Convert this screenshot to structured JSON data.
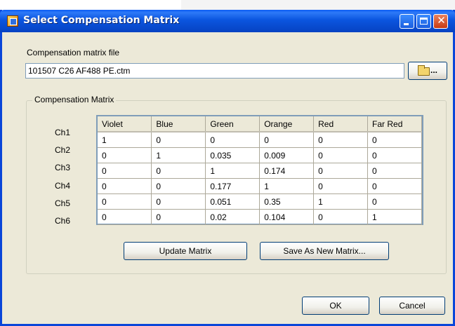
{
  "window": {
    "title": "Select Compensation Matrix",
    "controls": {
      "minimize": "minimize-icon",
      "maximize": "maximize-icon",
      "close": "close-icon",
      "close_glyph": "✕"
    }
  },
  "file": {
    "label": "Compensation  matrix file",
    "value": "101507 C26 AF488 PE.ctm",
    "browse_label": "..."
  },
  "matrix": {
    "group_label": "Compensation Matrix",
    "columns": [
      "Violet",
      "Blue",
      "Green",
      "Orange",
      "Red",
      "Far Red"
    ],
    "rows": [
      {
        "label": "Ch1",
        "values": [
          "1",
          "0",
          "0",
          "0",
          "0",
          "0"
        ]
      },
      {
        "label": "Ch2",
        "values": [
          "0",
          "1",
          "0.035",
          "0.009",
          "0",
          "0"
        ]
      },
      {
        "label": "Ch3",
        "values": [
          "0",
          "0",
          "1",
          "0.174",
          "0",
          "0"
        ]
      },
      {
        "label": "Ch4",
        "values": [
          "0",
          "0",
          "0.177",
          "1",
          "0",
          "0"
        ]
      },
      {
        "label": "Ch5",
        "values": [
          "0",
          "0",
          "0.051",
          "0.35",
          "1",
          "0"
        ]
      },
      {
        "label": "Ch6",
        "values": [
          "0",
          "0",
          "0.02",
          "0.104",
          "0",
          "1"
        ]
      }
    ]
  },
  "actions": {
    "update_label": "Update Matrix",
    "save_label": "Save As New Matrix...",
    "ok_label": "OK",
    "cancel_label": "Cancel"
  },
  "colors": {
    "titlebar": "#0a5bf3",
    "dialog_bg": "#ece9d8",
    "grid_border": "#7f9db9"
  }
}
